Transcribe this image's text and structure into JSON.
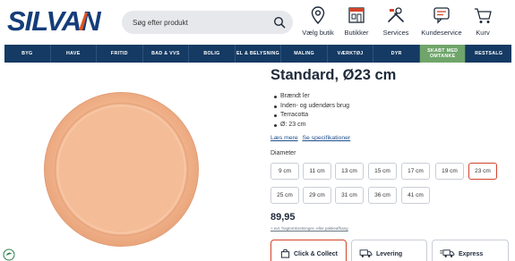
{
  "header": {
    "logo_text": "SILVAN",
    "search_placeholder": "Søg efter produkt",
    "nav": [
      {
        "label": "Vælg butik",
        "icon": "map-pin-icon"
      },
      {
        "label": "Butikker",
        "icon": "store-icon"
      },
      {
        "label": "Services",
        "icon": "services-tools-icon"
      },
      {
        "label": "Kundeservice",
        "icon": "chat-bubble-icon"
      },
      {
        "label": "Kurv",
        "icon": "shopping-cart-icon"
      }
    ]
  },
  "categories": [
    "BYG",
    "HAVE",
    "FRITID",
    "BAD & VVS",
    "BOLIG",
    "EL & BELYSNING",
    "MALING",
    "VÆRKTØJ",
    "DYR",
    "SKABT MED OMTANKE",
    "RESTSALG"
  ],
  "product": {
    "title": "Standard, Ø23 cm",
    "features": [
      "Brændt ler",
      "Inden- og udendørs brug",
      "Terracotta",
      "Ø: 23 cm"
    ],
    "links": [
      "Læs mere",
      "Se specifikationer"
    ],
    "diameter_label": "Diameter",
    "sizes": [
      "9 cm",
      "11 cm",
      "13 cm",
      "15 cm",
      "17 cm",
      "19 cm",
      "23 cm",
      "25 cm",
      "29 cm",
      "31 cm",
      "36 cm",
      "41 cm"
    ],
    "selected_size": "23 cm",
    "price": "89,95",
    "price_note": "+ evt. fragtomkostninger- eller pakkeafhang"
  },
  "delivery_options": [
    {
      "label": "Click & Collect",
      "icon": "shopping-bag-icon",
      "active": true
    },
    {
      "label": "Levering",
      "icon": "truck-icon",
      "active": false
    },
    {
      "label": "Express",
      "icon": "express-truck-icon",
      "active": false
    }
  ],
  "colors": {
    "brand_blue": "#143d7a",
    "nav_bar": "#153a63",
    "highlight_green": "#6fa56a",
    "selected_border": "#d1442b",
    "terracotta": "#f2b48f"
  }
}
